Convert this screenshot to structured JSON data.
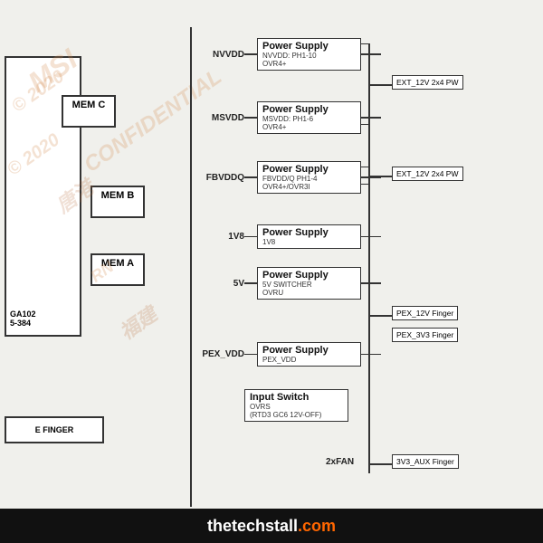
{
  "watermarks": {
    "msi": "MSI",
    "conf": "CONFIDENTIAL",
    "year1": "© 2020",
    "year2": "© 2020",
    "rng": "RN",
    "cn1": "唐港",
    "cn2": "福建"
  },
  "chips": {
    "mem_c": "MEM  C",
    "mem_b": "MEM  B",
    "mem_a": "MEM  A",
    "gpu_label": "GA102\n5-384",
    "finger_label": "E FINGER"
  },
  "power_supplies": [
    {
      "signal": "NVVDD",
      "title": "Power Supply",
      "sub1": "NVVDD: PH1-10",
      "sub2": "OVR4+",
      "right_label": "EXT_12V 2x4 PW"
    },
    {
      "signal": "MSVDD",
      "title": "Power Supply",
      "sub1": "MSVDD: PH1-6",
      "sub2": "OVR4+",
      "right_label": ""
    },
    {
      "signal": "FBVDDQ",
      "title": "Power Supply",
      "sub1": "FBVDD/Q PH1-4",
      "sub2": "OVR4+/OVR3I",
      "right_label": "EXT_12V 2x4 PW"
    },
    {
      "signal": "1V8",
      "title": "Power Supply",
      "sub1": "1V8",
      "sub2": "",
      "right_label": ""
    },
    {
      "signal": "5V",
      "title": "Power Supply",
      "sub1": "5V SWITCHER",
      "sub2": "OVRU",
      "right_label": ""
    },
    {
      "signal": "PEX_VDD",
      "title": "Power Supply",
      "sub1": "PEX_VDD",
      "sub2": "",
      "right_label": ""
    }
  ],
  "input_switch": {
    "title": "Input Switch",
    "sub1": "OVRS",
    "sub2": "(RTD3 GC6 12V-OFF)"
  },
  "pex_labels": [
    "PEX_12V Finger",
    "PEX_3V3 Finger"
  ],
  "fan_label": "2xFAN",
  "aux_label": "3V3_AUX Finger",
  "bottom_bar": {
    "text_normal": "thetechstall",
    "text_orange": ".com",
    "full": "thetechstall.com"
  }
}
